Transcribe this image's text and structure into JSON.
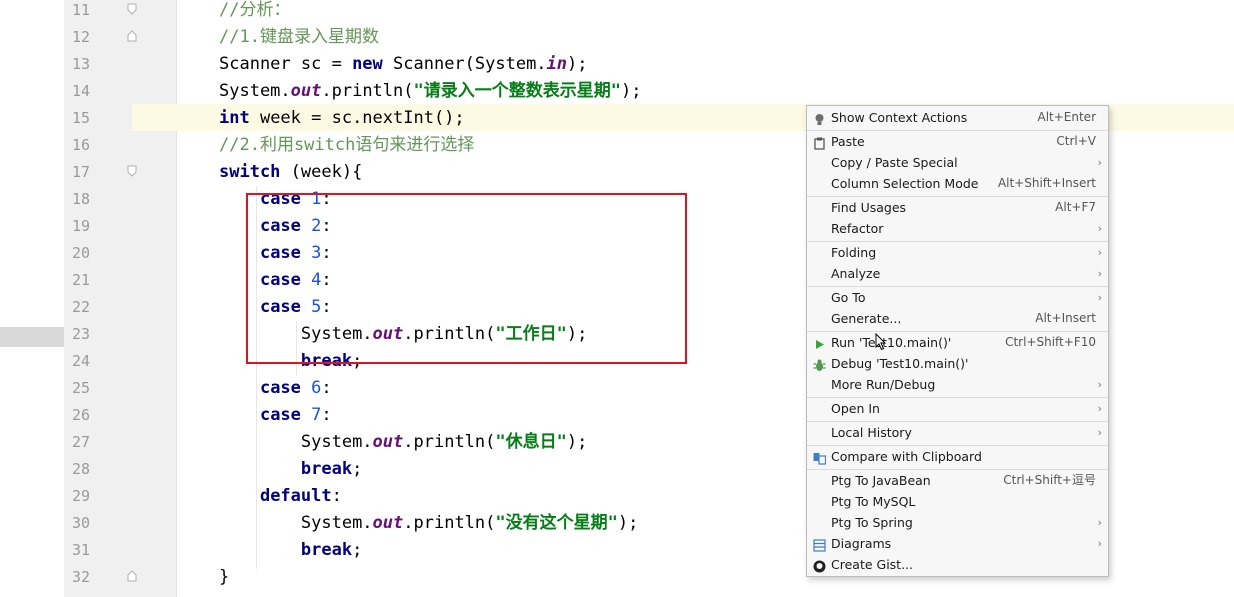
{
  "editor": {
    "line_numbers": [
      "11",
      "12",
      "13",
      "14",
      "15",
      "16",
      "17",
      "18",
      "19",
      "20",
      "21",
      "22",
      "23",
      "24",
      "25",
      "26",
      "27",
      "28",
      "29",
      "30",
      "31",
      "32"
    ],
    "lines": {
      "l11": {
        "comment": "//分析："
      },
      "l12": {
        "comment": "//1.键盘录入星期数"
      },
      "l13": {
        "a": "Scanner sc = ",
        "kw": "new",
        "b": " Scanner(System.",
        "field": "in",
        "c": ");"
      },
      "l14": {
        "a": "System.",
        "field": "out",
        "b": ".println(",
        "str": "\"请录入一个整数表示星期\"",
        "c": ");"
      },
      "l15": {
        "kw": "int",
        "a": " week = sc.nextInt();"
      },
      "l16": {
        "comment": "//2.利用switch语句来进行选择"
      },
      "l17": {
        "kw": "switch",
        "a": " (week){"
      },
      "l18": {
        "kw": "case",
        "num": "1",
        "c": ":"
      },
      "l19": {
        "kw": "case",
        "num": "2",
        "c": ":"
      },
      "l20": {
        "kw": "case",
        "num": "3",
        "c": ":"
      },
      "l21": {
        "kw": "case",
        "num": "4",
        "c": ":"
      },
      "l22": {
        "kw": "case",
        "num": "5",
        "c": ":"
      },
      "l23": {
        "a": "System.",
        "field": "out",
        "b": ".println(",
        "str": "\"工作日\"",
        "c": ");"
      },
      "l24": {
        "kw": "break",
        "c": ";"
      },
      "l25": {
        "kw": "case",
        "num": "6",
        "c": ":"
      },
      "l26": {
        "kw": "case",
        "num": "7",
        "c": ":"
      },
      "l27": {
        "a": "System.",
        "field": "out",
        "b": ".println(",
        "str": "\"休息日\"",
        "c": ");"
      },
      "l28": {
        "kw": "break",
        "c": ";"
      },
      "l29": {
        "kw": "default",
        "c": ":"
      },
      "l30": {
        "a": "System.",
        "field": "out",
        "b": ".println(",
        "str": "\"没有这个星期\"",
        "c": ");"
      },
      "l31": {
        "kw": "break",
        "c": ";"
      },
      "l32": {
        "a": "}"
      }
    }
  },
  "context_menu": {
    "items": [
      {
        "label": "Show Context Actions",
        "shortcut": "Alt+Enter",
        "icon": "lightbulb-icon"
      },
      {
        "label": "Paste",
        "shortcut": "Ctrl+V",
        "icon": "clipboard-icon"
      },
      {
        "label": "Copy / Paste Special",
        "submenu": "›"
      },
      {
        "label": "Column Selection Mode",
        "shortcut": "Alt+Shift+Insert"
      },
      {
        "label": "Find Usages",
        "shortcut": "Alt+F7"
      },
      {
        "label": "Refactor",
        "submenu": "›"
      },
      {
        "label": "Folding",
        "submenu": "›"
      },
      {
        "label": "Analyze",
        "submenu": "›"
      },
      {
        "label": "Go To",
        "submenu": "›"
      },
      {
        "label": "Generate...",
        "shortcut": "Alt+Insert"
      },
      {
        "label": "Run 'Test10.main()'",
        "shortcut": "Ctrl+Shift+F10",
        "icon": "run-icon"
      },
      {
        "label": "Debug 'Test10.main()'",
        "icon": "debug-icon"
      },
      {
        "label": "More Run/Debug",
        "submenu": "›"
      },
      {
        "label": "Open In",
        "submenu": "›"
      },
      {
        "label": "Local History",
        "submenu": "›"
      },
      {
        "label": "Compare with Clipboard",
        "icon": "compare-icon"
      },
      {
        "label": "Ptg To JavaBean",
        "shortcut": "Ctrl+Shift+逗号"
      },
      {
        "label": "Ptg To MySQL"
      },
      {
        "label": "Ptg To Spring",
        "submenu": "›"
      },
      {
        "label": "Diagrams",
        "submenu": "›",
        "icon": "diagram-icon"
      },
      {
        "label": "Create Gist...",
        "icon": "github-icon"
      }
    ]
  },
  "colors": {
    "keyword": "#000080",
    "string": "#067d17",
    "number": "#1750eb",
    "field": "#660e7a",
    "highlight_box": "#e0141e",
    "current_line": "#fcfae2"
  }
}
